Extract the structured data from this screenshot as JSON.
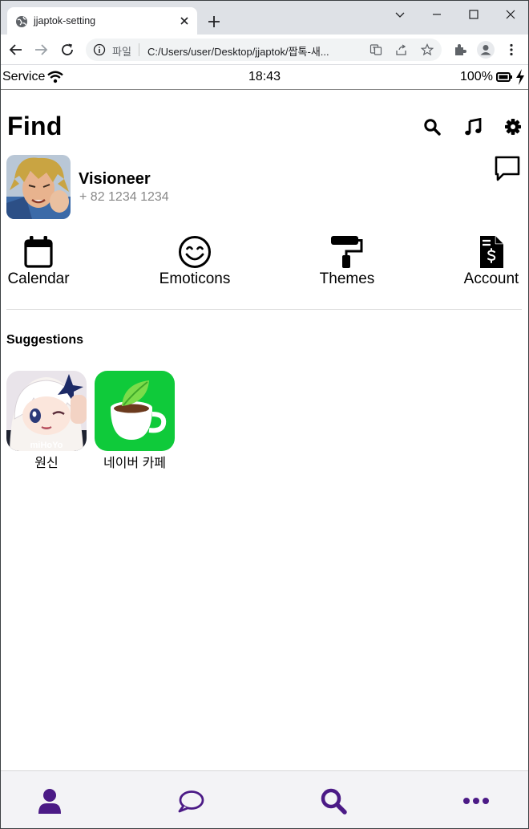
{
  "browser": {
    "tab_title": "jjaptok-setting",
    "scheme_label": "파일",
    "url": "C:/Users/user/Desktop/jjaptok/짭톡-새..."
  },
  "status": {
    "carrier": "Service",
    "time": "18:43",
    "battery": "100%"
  },
  "page": {
    "title": "Find",
    "header_icons": [
      "search-icon",
      "music-icon",
      "gear-icon"
    ]
  },
  "profile": {
    "name": "Visioneer",
    "phone": "+ 82 1234 1234"
  },
  "features": [
    {
      "label": "Calendar",
      "icon": "calendar-icon"
    },
    {
      "label": "Emoticons",
      "icon": "smile-icon"
    },
    {
      "label": "Themes",
      "icon": "paint-roller-icon"
    },
    {
      "label": "Account",
      "icon": "invoice-dollar-icon"
    }
  ],
  "suggestions": {
    "title": "Suggestions",
    "apps": [
      {
        "name": "원신",
        "icon": "genshin-app-icon"
      },
      {
        "name": "네이버 카페",
        "icon": "naver-cafe-app-icon"
      }
    ]
  },
  "bottom_nav": {
    "items": [
      "user-icon",
      "chat-icon",
      "search-icon",
      "more-icon"
    ],
    "accent": "#4b1a86"
  }
}
